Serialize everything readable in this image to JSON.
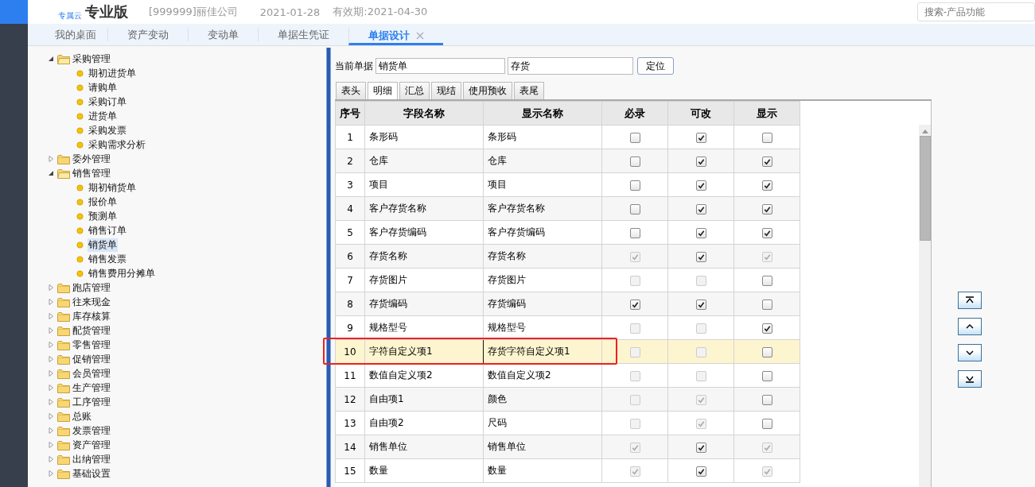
{
  "header": {
    "cloud_label": "专属云",
    "product": "专业版",
    "company": "[999999]丽佳公司",
    "date": "2021-01-28",
    "expiry": "有效期:2021-04-30",
    "search": {
      "placeholder": "搜索-产品功能"
    }
  },
  "nav_tabs": [
    {
      "label": "我的桌面",
      "selected": false
    },
    {
      "label": "资产变动",
      "selected": false
    },
    {
      "label": "变动单",
      "selected": false
    },
    {
      "label": "单据生凭证",
      "selected": false
    },
    {
      "label": "单据设计",
      "selected": true,
      "closable": true
    }
  ],
  "tree": [
    {
      "label": "采购管理",
      "expanded": true,
      "children": [
        {
          "label": "期初进货单",
          "selected": false
        },
        {
          "label": "请购单",
          "selected": false
        },
        {
          "label": "采购订单",
          "selected": false
        },
        {
          "label": "进货单",
          "selected": false
        },
        {
          "label": "采购发票",
          "selected": false
        },
        {
          "label": "采购需求分析",
          "selected": false
        }
      ]
    },
    {
      "label": "委外管理",
      "expanded": false
    },
    {
      "label": "销售管理",
      "expanded": true,
      "children": [
        {
          "label": "期初销货单",
          "selected": false
        },
        {
          "label": "报价单",
          "selected": false
        },
        {
          "label": "预测单",
          "selected": false
        },
        {
          "label": "销售订单",
          "selected": false
        },
        {
          "label": "销货单",
          "selected": true
        },
        {
          "label": "销售发票",
          "selected": false
        },
        {
          "label": "销售费用分摊单",
          "selected": false
        }
      ]
    },
    {
      "label": "跑店管理",
      "expanded": false
    },
    {
      "label": "往来现金",
      "expanded": false
    },
    {
      "label": "库存核算",
      "expanded": false
    },
    {
      "label": "配货管理",
      "expanded": false
    },
    {
      "label": "零售管理",
      "expanded": false
    },
    {
      "label": "促销管理",
      "expanded": false
    },
    {
      "label": "会员管理",
      "expanded": false
    },
    {
      "label": "生产管理",
      "expanded": false
    },
    {
      "label": "工序管理",
      "expanded": false
    },
    {
      "label": "总账",
      "expanded": false
    },
    {
      "label": "发票管理",
      "expanded": false
    },
    {
      "label": "资产管理",
      "expanded": false
    },
    {
      "label": "出纳管理",
      "expanded": false
    },
    {
      "label": "基础设置",
      "expanded": false
    }
  ],
  "form": {
    "label": "当前单据",
    "document": "销货单",
    "search_value": "存货",
    "locate_button": "定位"
  },
  "sub_tabs": [
    {
      "label": "表头",
      "selected": false
    },
    {
      "label": "明细",
      "selected": true
    },
    {
      "label": "汇总",
      "selected": false
    },
    {
      "label": "现结",
      "selected": false
    },
    {
      "label": "使用预收",
      "selected": false
    },
    {
      "label": "表尾",
      "selected": false
    }
  ],
  "table": {
    "columns": [
      "序号",
      "字段名称",
      "显示名称",
      "必录",
      "可改",
      "显示"
    ],
    "rows": [
      {
        "no": "1",
        "field": "条形码",
        "display": "条形码",
        "selected": false,
        "required": {
          "checked": false,
          "disabled": false
        },
        "editable": {
          "checked": true,
          "disabled": false
        },
        "visible": {
          "checked": false,
          "disabled": false
        }
      },
      {
        "no": "2",
        "field": "仓库",
        "display": "仓库",
        "selected": false,
        "required": {
          "checked": false,
          "disabled": false
        },
        "editable": {
          "checked": true,
          "disabled": false
        },
        "visible": {
          "checked": true,
          "disabled": false
        }
      },
      {
        "no": "3",
        "field": "项目",
        "display": "项目",
        "selected": false,
        "required": {
          "checked": false,
          "disabled": false
        },
        "editable": {
          "checked": true,
          "disabled": false
        },
        "visible": {
          "checked": true,
          "disabled": false
        }
      },
      {
        "no": "4",
        "field": "客户存货名称",
        "display": "客户存货名称",
        "selected": false,
        "required": {
          "checked": false,
          "disabled": false
        },
        "editable": {
          "checked": true,
          "disabled": false
        },
        "visible": {
          "checked": true,
          "disabled": false
        }
      },
      {
        "no": "5",
        "field": "客户存货编码",
        "display": "客户存货编码",
        "selected": false,
        "required": {
          "checked": false,
          "disabled": false
        },
        "editable": {
          "checked": true,
          "disabled": false
        },
        "visible": {
          "checked": true,
          "disabled": false
        }
      },
      {
        "no": "6",
        "field": "存货名称",
        "display": "存货名称",
        "selected": false,
        "required": {
          "checked": true,
          "disabled": true
        },
        "editable": {
          "checked": true,
          "disabled": false
        },
        "visible": {
          "checked": true,
          "disabled": true
        }
      },
      {
        "no": "7",
        "field": "存货图片",
        "display": "存货图片",
        "selected": false,
        "required": {
          "checked": false,
          "disabled": true
        },
        "editable": {
          "checked": false,
          "disabled": true
        },
        "visible": {
          "checked": false,
          "disabled": false
        }
      },
      {
        "no": "8",
        "field": "存货编码",
        "display": "存货编码",
        "selected": false,
        "required": {
          "checked": true,
          "disabled": false
        },
        "editable": {
          "checked": true,
          "disabled": false
        },
        "visible": {
          "checked": false,
          "disabled": false
        }
      },
      {
        "no": "9",
        "field": "规格型号",
        "display": "规格型号",
        "selected": false,
        "required": {
          "checked": false,
          "disabled": true
        },
        "editable": {
          "checked": false,
          "disabled": true
        },
        "visible": {
          "checked": true,
          "disabled": false
        }
      },
      {
        "no": "10",
        "field": "字符自定义项1",
        "display": "存货字符自定义项1",
        "selected": true,
        "required": {
          "checked": false,
          "disabled": true
        },
        "editable": {
          "checked": false,
          "disabled": true
        },
        "visible": {
          "checked": false,
          "disabled": false
        }
      },
      {
        "no": "11",
        "field": "数值自定义项2",
        "display": "数值自定义项2",
        "selected": false,
        "required": {
          "checked": false,
          "disabled": true
        },
        "editable": {
          "checked": false,
          "disabled": true
        },
        "visible": {
          "checked": false,
          "disabled": false
        }
      },
      {
        "no": "12",
        "field": "自由项1",
        "display": "颜色",
        "selected": false,
        "required": {
          "checked": false,
          "disabled": true
        },
        "editable": {
          "checked": true,
          "disabled": true
        },
        "visible": {
          "checked": false,
          "disabled": false
        }
      },
      {
        "no": "13",
        "field": "自由项2",
        "display": "尺码",
        "selected": false,
        "required": {
          "checked": false,
          "disabled": true
        },
        "editable": {
          "checked": true,
          "disabled": true
        },
        "visible": {
          "checked": false,
          "disabled": false
        }
      },
      {
        "no": "14",
        "field": "销售单位",
        "display": "销售单位",
        "selected": false,
        "required": {
          "checked": true,
          "disabled": true
        },
        "editable": {
          "checked": true,
          "disabled": false
        },
        "visible": {
          "checked": true,
          "disabled": true
        }
      },
      {
        "no": "15",
        "field": "数量",
        "display": "数量",
        "selected": false,
        "required": {
          "checked": true,
          "disabled": true
        },
        "editable": {
          "checked": true,
          "disabled": false
        },
        "visible": {
          "checked": true,
          "disabled": true
        }
      }
    ]
  }
}
